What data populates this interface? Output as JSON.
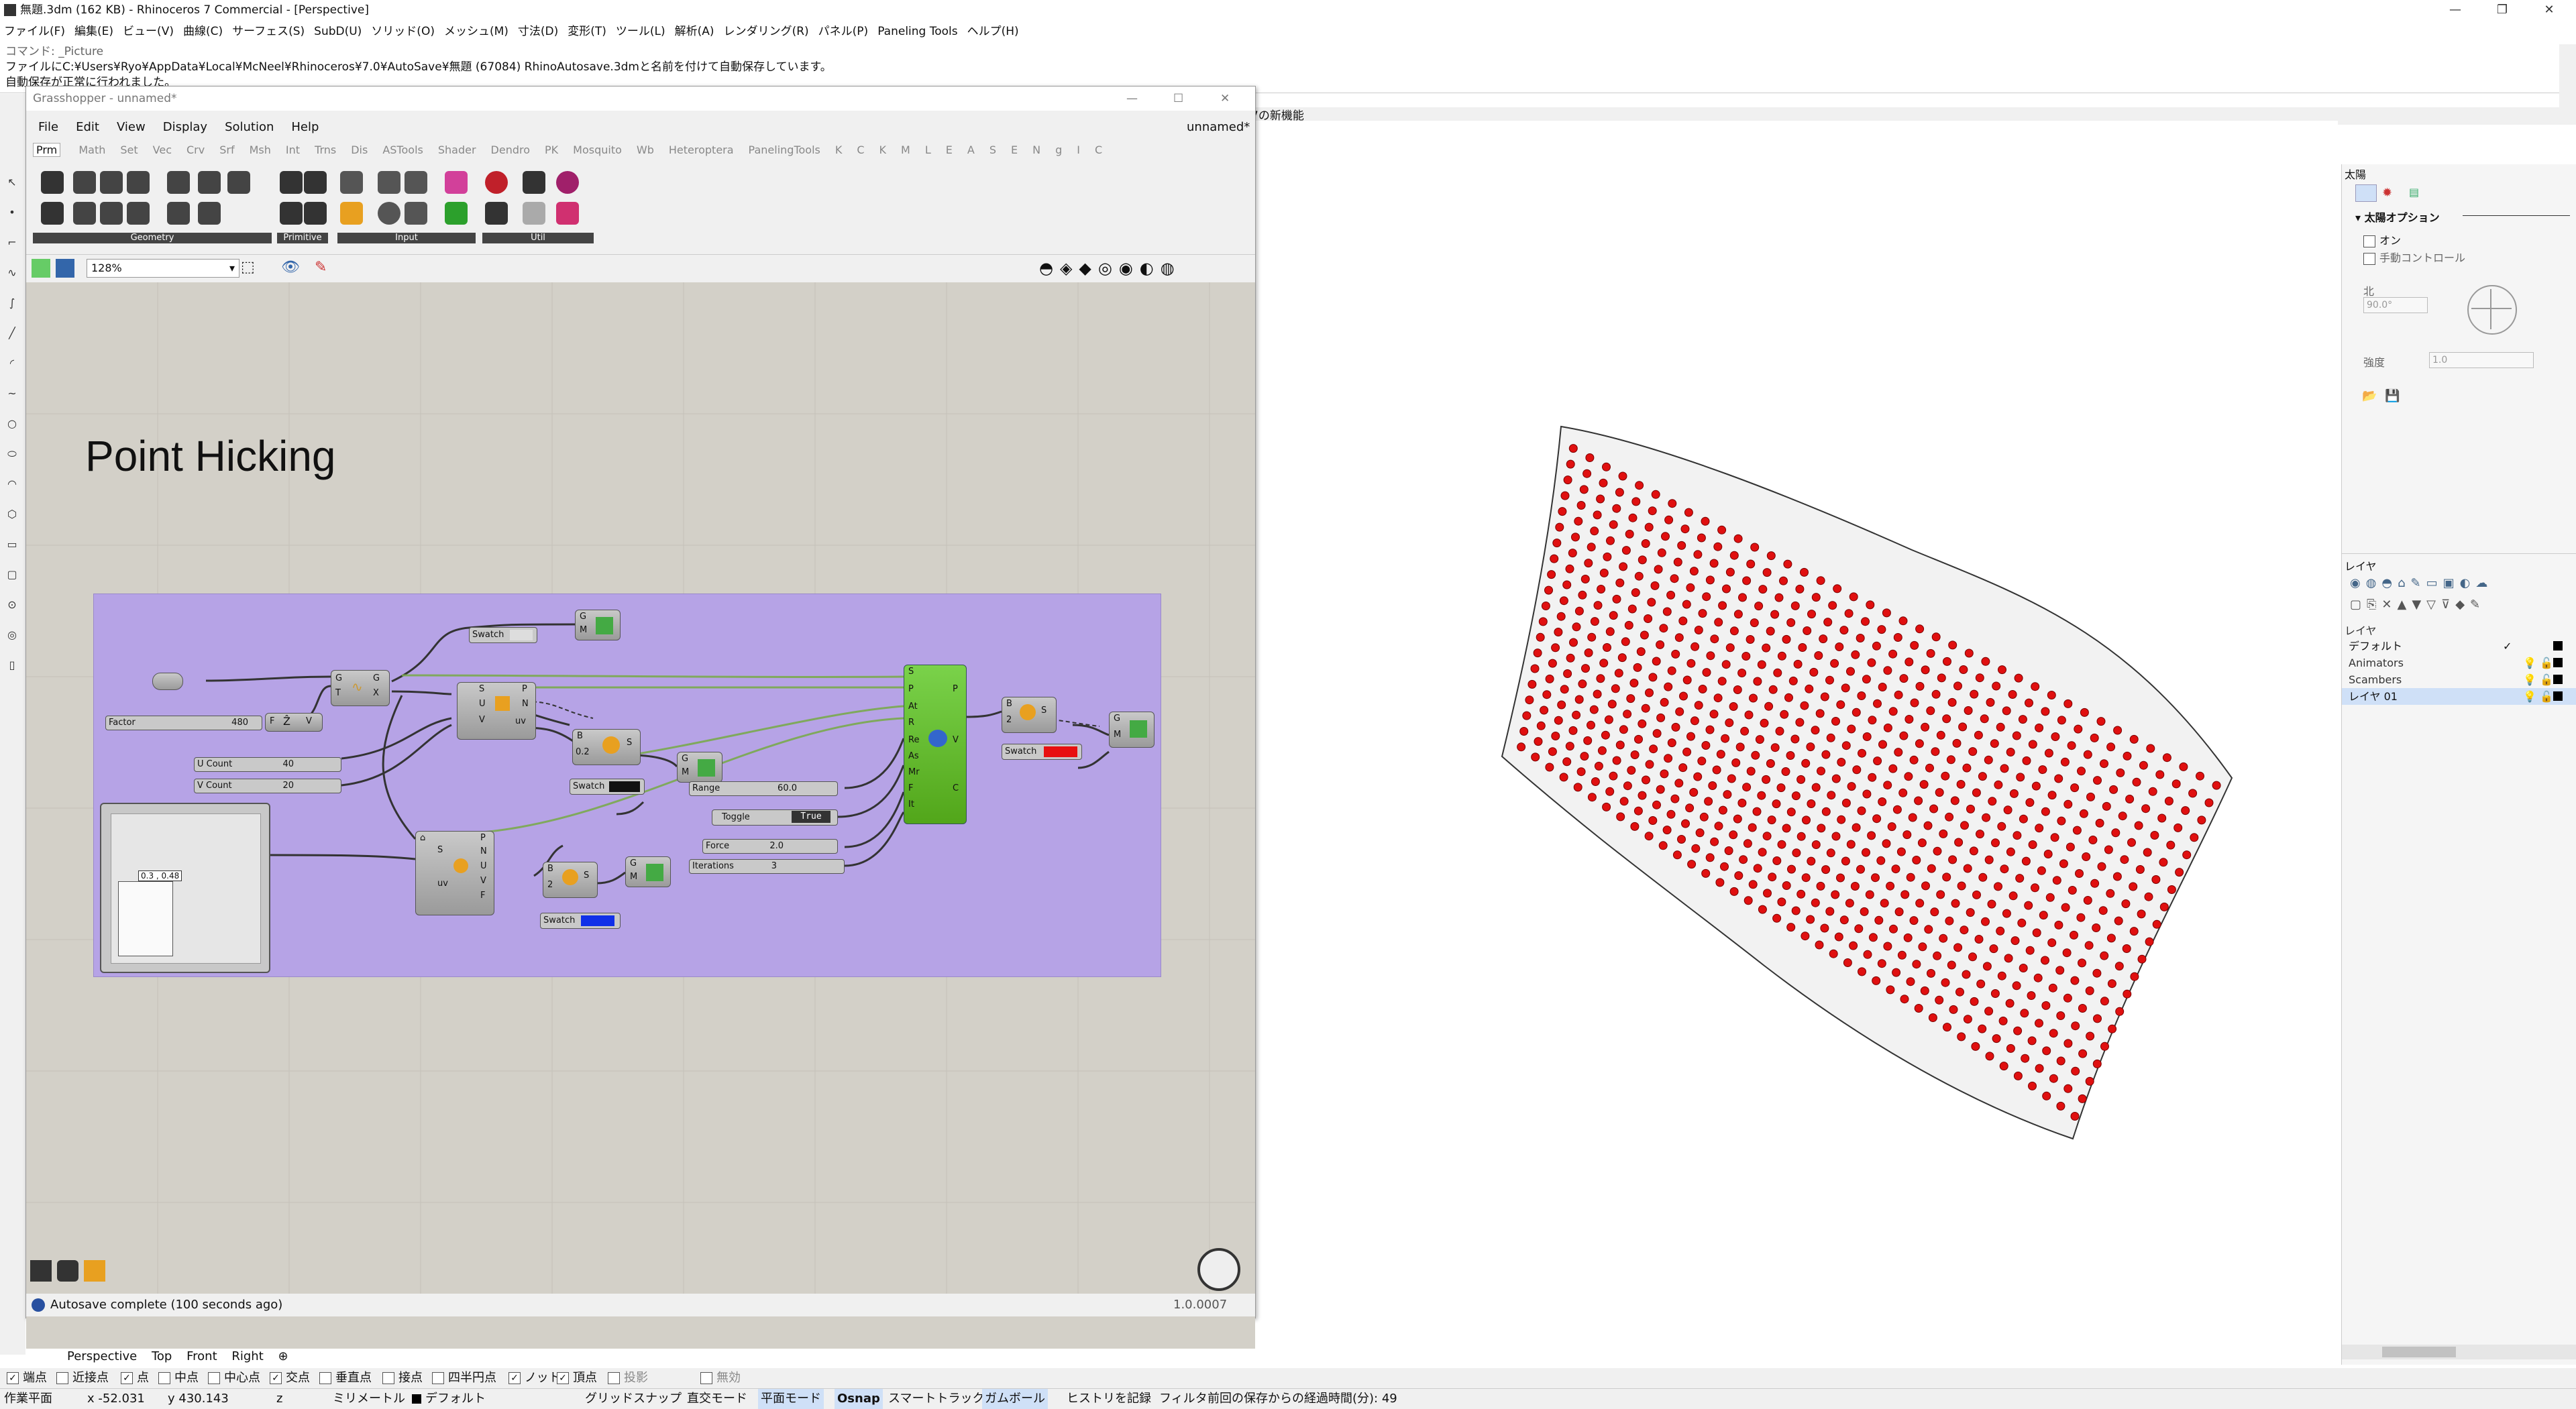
{
  "rhino": {
    "title": "無題.3dm (162 KB) - Rhinoceros 7 Commercial - [Perspective]",
    "menu": [
      "ファイル(F)",
      "編集(E)",
      "ビュー(V)",
      "曲線(C)",
      "サーフェス(S)",
      "SubD(U)",
      "ソリッド(O)",
      "メッシュ(M)",
      "寸法(D)",
      "変形(T)",
      "ツール(L)",
      "解析(A)",
      "レンダリング(R)",
      "パネル(P)",
      "Paneling Tools",
      "ヘルプ(H)"
    ],
    "command_lines": [
      "コマンド: _Picture",
      "ファイルにC:¥Users¥Ryo¥AppData¥Local¥McNeel¥Rhinoceros¥7.0¥AutoSave¥無題 (67084) RhinoAutosave.3dmと名前を付けて自動保存しています。",
      "自動保存が正常に行われました。"
    ],
    "viewport_tab_partial": "7の新機能"
  },
  "grasshopper": {
    "title": "Grasshopper - unnamed*",
    "doc_name": "unnamed*",
    "menu": [
      "File",
      "Edit",
      "View",
      "Display",
      "Solution",
      "Help"
    ],
    "tabs": [
      "Prm",
      "Math",
      "Set",
      "Vec",
      "Crv",
      "Srf",
      "Msh",
      "Int",
      "Trns",
      "Dis",
      "ASTools",
      "Shader",
      "Dendro",
      "PK",
      "Mosquito",
      "Wb",
      "Heteroptera",
      "PanelingTools",
      "K",
      "C",
      "K",
      "M",
      "L",
      "E",
      "A",
      "S",
      "E",
      "N",
      "g",
      "I",
      "C"
    ],
    "toolbar_groups": [
      "Geometry",
      "Primitive",
      "Input",
      "Util"
    ],
    "zoom": "128%",
    "canvas_title": "Point Hicking",
    "status": "Autosave complete (100 seconds ago)",
    "version": "1.0.0007",
    "components": {
      "factor_label": "Factor",
      "factor_value": "480",
      "ucount_label": "U Count",
      "ucount_value": "40",
      "vcount_label": "V Count",
      "vcount_value": "20",
      "range_label": "Range",
      "range_value": "60.0",
      "toggle_label": "Toggle",
      "toggle_value": "True",
      "force_label": "Force",
      "force_value": "2.0",
      "iterations_label": "Iterations",
      "iterations_value": "3",
      "swatch_label": "Swatch",
      "num_02": "0.2",
      "graph_readout": "0.3 , 0.48"
    }
  },
  "right_panel": {
    "sun_title": "太陽",
    "sun_options": "太陽オプション",
    "on_label": "オン",
    "manual_label": "手動コントロール",
    "north_label": "北",
    "north_value": "90.0°",
    "intensity_label": "強度",
    "intensity_value": "1.0",
    "layers_title": "レイヤ",
    "layer_header": "レイヤ",
    "layers": [
      {
        "name": "デフォルト",
        "current": true,
        "color": "#000000"
      },
      {
        "name": "Animators",
        "current": false,
        "color": "#000000"
      },
      {
        "name": "Scambers",
        "current": false,
        "color": "#000000"
      },
      {
        "name": "レイヤ 01",
        "current": false,
        "color": "#000000"
      }
    ]
  },
  "viewport_tabs": [
    "Perspective",
    "Top",
    "Front",
    "Right"
  ],
  "osnap": [
    {
      "label": "端点",
      "on": true
    },
    {
      "label": "近接点",
      "on": false
    },
    {
      "label": "点",
      "on": true
    },
    {
      "label": "中点",
      "on": false
    },
    {
      "label": "中心点",
      "on": false
    },
    {
      "label": "交点",
      "on": true
    },
    {
      "label": "垂直点",
      "on": false
    },
    {
      "label": "接点",
      "on": false
    },
    {
      "label": "四半円点",
      "on": false
    },
    {
      "label": "ノット",
      "on": true
    },
    {
      "label": "頂点",
      "on": true
    },
    {
      "label": "投影",
      "on": false
    },
    {
      "label": "無効",
      "on": false
    }
  ],
  "status": {
    "plane": "作業平面",
    "x": "x -52.031",
    "y": "y 430.143",
    "z": "z",
    "unit": "ミリメートル",
    "layer": "デフォルト",
    "grid_snap": "グリッドスナップ",
    "ortho": "直交モード",
    "planar": "平面モード",
    "osnap": "Osnap",
    "smarttrack": "スマートトラック",
    "gumball": "ガムボール",
    "history": "ヒストリを記録",
    "filter": "フィルタ",
    "elapsed": "前回の保存からの経過時間(分): 49"
  },
  "colors": {
    "accent": "#cfe0f7",
    "point": "#e01010",
    "group": "#b6a3e6",
    "ghgreen": "#6ccb1e"
  }
}
